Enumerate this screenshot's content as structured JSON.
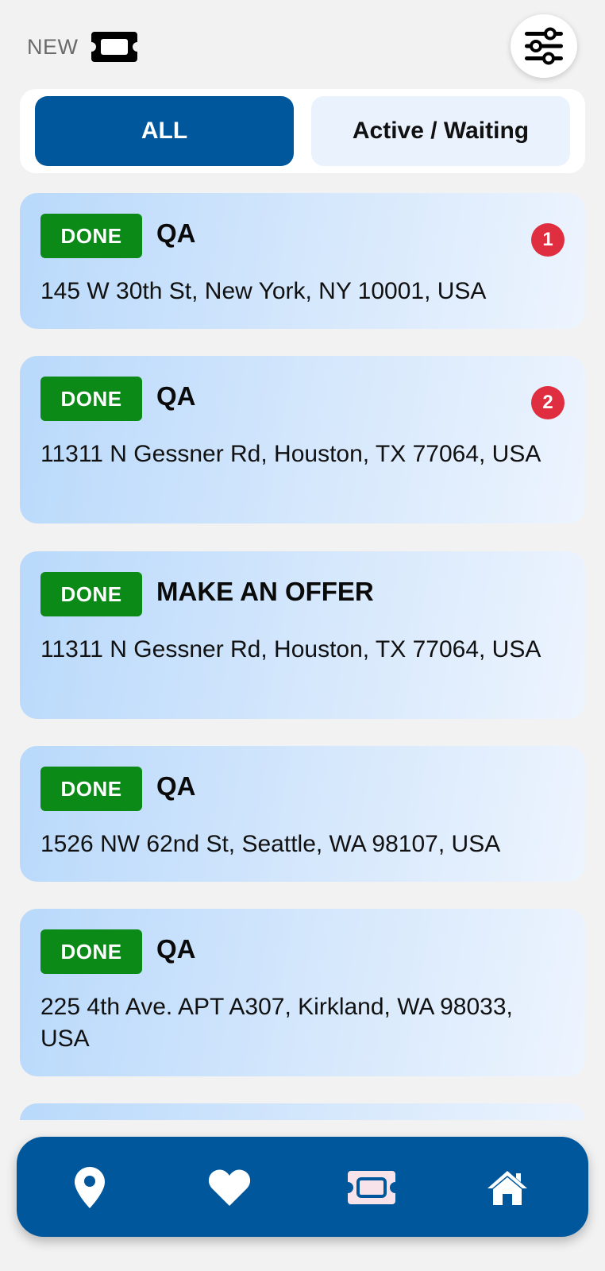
{
  "header": {
    "new_label": "NEW",
    "ticket_icon": "ticket-icon",
    "filter_icon": "sliders-icon"
  },
  "tabs": [
    {
      "label": "ALL",
      "selected": true
    },
    {
      "label": "Active / Waiting",
      "selected": false
    }
  ],
  "cards": [
    {
      "status": "DONE",
      "title": "QA",
      "address": "145 W 30th St, New York, NY 10001, USA",
      "count": "1"
    },
    {
      "status": "DONE",
      "title": "QA",
      "address": "11311 N Gessner Rd, Houston, TX 77064, USA",
      "count": "2"
    },
    {
      "status": "DONE",
      "title": "MAKE AN OFFER",
      "address": "11311 N Gessner Rd, Houston, TX 77064, USA"
    },
    {
      "status": "DONE",
      "title": "QA",
      "address": "1526 NW 62nd St, Seattle, WA 98107, USA"
    },
    {
      "status": "DONE",
      "title": "QA",
      "address": "225 4th Ave. APT A307, Kirkland, WA 98033, USA"
    }
  ],
  "bottom_nav": [
    {
      "icon": "location-pin-icon"
    },
    {
      "icon": "heart-icon"
    },
    {
      "icon": "ticket-icon"
    },
    {
      "icon": "home-icon"
    }
  ],
  "colors": {
    "primary": "#00579b",
    "done_badge": "#0b8a17",
    "count_badge": "#df2e3f",
    "background": "#f2f2f2"
  }
}
